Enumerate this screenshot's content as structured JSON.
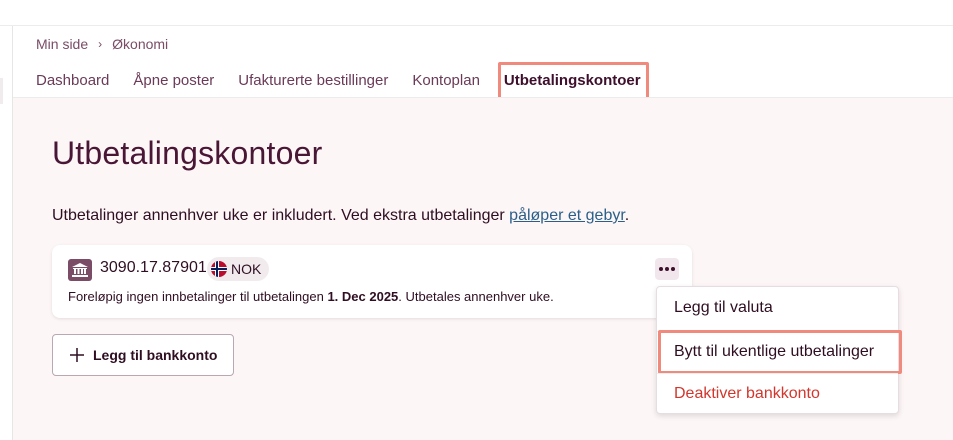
{
  "breadcrumb": {
    "home": "Min side",
    "current": "Økonomi"
  },
  "tabs": [
    {
      "label": "Dashboard"
    },
    {
      "label": "Åpne poster"
    },
    {
      "label": "Ufakturerte bestillinger"
    },
    {
      "label": "Kontoplan"
    },
    {
      "label": "Utbetalingskontoer",
      "active": true
    }
  ],
  "page": {
    "title": "Utbetalingskontoer",
    "info_text": "Utbetalinger annenhver uke er inkludert. Ved ekstra utbetalinger ",
    "info_link": "påløper et gebyr",
    "info_end": "."
  },
  "account": {
    "number": "3090.17.87901",
    "currency": "NOK",
    "desc_pre": "Foreløpig ingen innbetalinger til utbetalingen ",
    "desc_date": "1. Dec 2025",
    "desc_post": ". Utbetales annenhver uke."
  },
  "add_bank_label": "Legg til bankkonto",
  "menu": {
    "items": [
      {
        "label": "Legg til valuta"
      },
      {
        "label": "Bytt til ukentlige utbetalinger"
      },
      {
        "label": "Deaktiver bankkonto"
      }
    ]
  },
  "colors": {
    "accent": "#4a1635",
    "highlight": "#f08a7c",
    "danger": "#d2362c",
    "link": "#2b5f8a"
  }
}
